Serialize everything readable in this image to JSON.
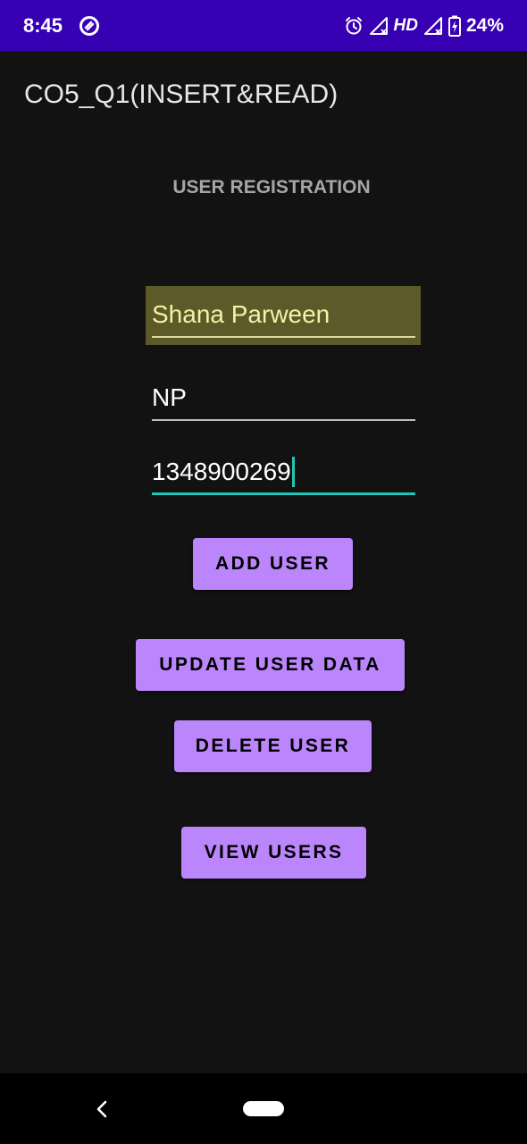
{
  "status_bar": {
    "time": "8:45",
    "hd": "HD",
    "battery": "24%",
    "icons": [
      "app-notification-icon",
      "alarm-icon",
      "signal-icon",
      "signal-icon",
      "battery-charging-icon"
    ],
    "background": "#3700b3"
  },
  "app_bar": {
    "title": "CO5_Q1(INSERT&READ)"
  },
  "form": {
    "heading": "USER REGISTRATION",
    "name_value": "Shana Parween",
    "email_value": "NP",
    "phone_value": "1348900269"
  },
  "buttons": {
    "add": "ADD USER",
    "update": "UPDATE USER DATA",
    "delete": "DELETE USER",
    "view": "VIEW USERS"
  },
  "nav": {
    "icons": [
      "back-icon",
      "home-pill-icon"
    ]
  },
  "colors": {
    "accent": "#bb86fc",
    "background": "#121212",
    "focus_line": "#1dc7b3",
    "autofill_highlight": "#5c5a28"
  }
}
